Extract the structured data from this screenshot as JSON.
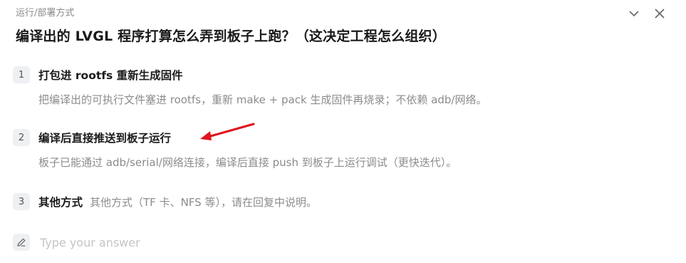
{
  "header": {
    "category": "运行/部署方式",
    "collapse_icon": "chevron-down-icon",
    "close_icon": "close-icon"
  },
  "question": "编译出的 LVGL 程序打算怎么弄到板子上跑？（这决定工程怎么组织）",
  "options": [
    {
      "num": "1",
      "label": "打包进 rootfs 重新生成固件",
      "desc": "把编译出的可执行文件塞进 rootfs，重新 make + pack 生成固件再烧录；不依赖 adb/网络。"
    },
    {
      "num": "2",
      "label": "编译后直接推送到板子运行",
      "desc": "板子已能通过 adb/serial/网络连接，编译后直接 push 到板子上运行调试（更快迭代）。"
    },
    {
      "num": "3",
      "label": "其他方式",
      "desc": "其他方式（TF 卡、NFS 等），请在回复中说明。"
    }
  ],
  "answer": {
    "placeholder": "Type your answer",
    "icon": "pencil-icon"
  },
  "annotation": {
    "arrow_color": "#e0141e"
  }
}
